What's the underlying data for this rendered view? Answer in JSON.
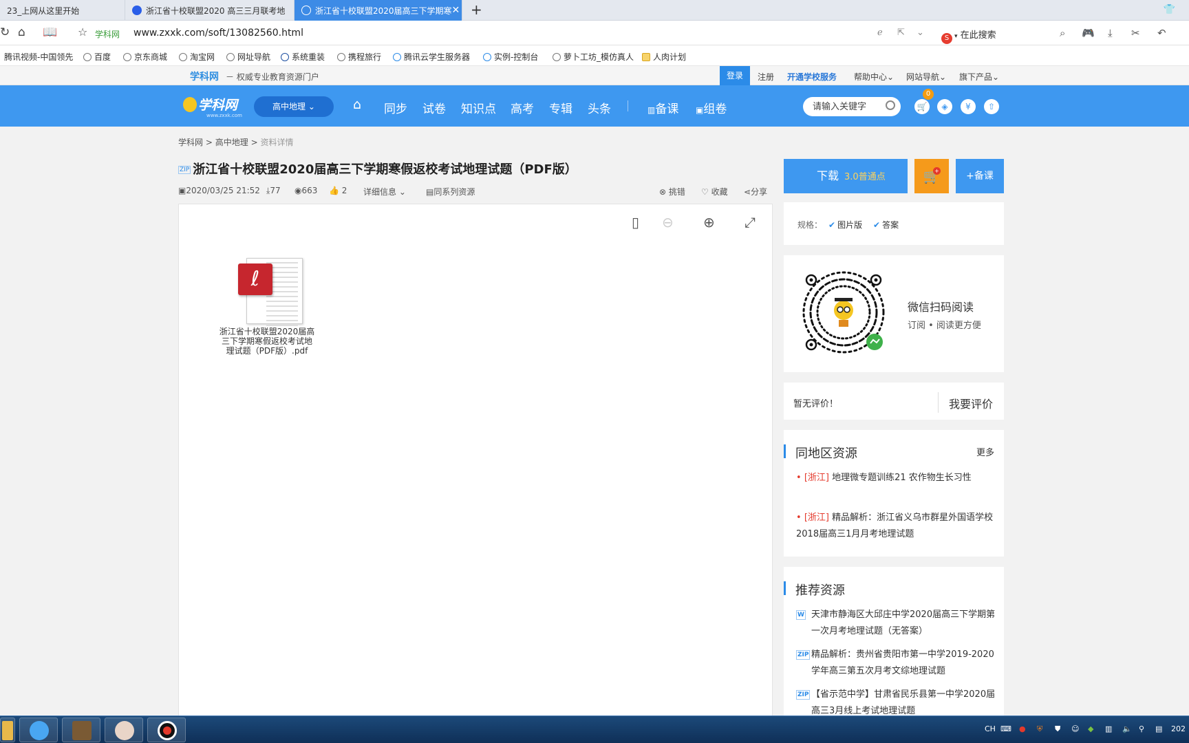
{
  "browser": {
    "tabs": [
      {
        "label": "23_上网从这里开始"
      },
      {
        "label": "浙江省十校联盟2020 高三三月联考地"
      },
      {
        "label": "浙江省十校联盟2020届高三下学期寒"
      }
    ],
    "site_label": "学科网",
    "url": "www.zxxk.com/soft/13082560.html",
    "search_placeholder": "在此搜索",
    "bookmarks": [
      "腾讯视频-中国领先",
      "百度",
      "京东商城",
      "淘宝网",
      "网址导航",
      "系统重装",
      "携程旅行",
      "腾讯云学生服务器",
      "实例-控制台",
      "萝卜工坊_模仿真人",
      "人肉计划"
    ]
  },
  "site_top": {
    "logo": "学科网",
    "slogan": "－ 权威专业教育资源门户",
    "login": "登录",
    "register": "注册",
    "school_service": "开通学校服务",
    "help": "帮助中心",
    "site_nav": "网站导航",
    "products": "旗下产品"
  },
  "header": {
    "brand": "学科网",
    "brand_sub": "www.zxxk.com",
    "subject": "高中地理",
    "nav": [
      "同步",
      "试卷",
      "知识点",
      "高考",
      "专辑",
      "头条"
    ],
    "nav_extra": [
      "备课",
      "组卷"
    ],
    "search_placeholder": "请输入关键字",
    "cart_count": "0"
  },
  "breadcrumb": [
    "学科网",
    "高中地理",
    "资料详情"
  ],
  "doc": {
    "file_type": "ZIP",
    "title": "浙江省十校联盟2020届高三下学期寒假返校考试地理试题（PDF版）",
    "date": "2020/03/25 21:52",
    "downloads": "77",
    "views": "663",
    "likes": "2",
    "detail_info": "详细信息",
    "series": "同系列资源",
    "report": "挑错",
    "favorite": "收藏",
    "share": "分享",
    "file_name": "浙江省十校联盟2020届高三下学期寒假返校考试地理试题（PDF版）.pdf"
  },
  "sidebar": {
    "download": "下载",
    "points": "3.0普通点",
    "prep": "+备课",
    "spec_label": "规格：",
    "specs": [
      "图片版",
      "答案"
    ],
    "wechat_title": "微信扫码阅读",
    "wechat_sub": "订阅 • 阅读更方便",
    "no_review": "暂无评价！",
    "write_review": "我要评价",
    "local_title": "同地区资源",
    "more": "更多",
    "local_items": [
      {
        "tag": "[浙江]",
        "text": "地理微专题训练21 农作物生长习性"
      },
      {
        "tag": "[浙江]",
        "text": "精品解析：浙江省义乌市群星外国语学校2018届高三1月月考地理试题"
      }
    ],
    "recommend_title": "推荐资源",
    "recommend_items": [
      {
        "type": "W",
        "text": "天津市静海区大邱庄中学2020届高三下学期第一次月考地理试题（无答案）"
      },
      {
        "type": "ZIP",
        "text": "精品解析：贵州省贵阳市第一中学2019-2020学年高三第五次月考文综地理试题"
      },
      {
        "type": "ZIP",
        "text": "【省示范中学】甘肃省民乐县第一中学2020届高三3月线上考试地理试题"
      }
    ]
  },
  "taskbar": {
    "lang": "CH",
    "clock": "202"
  }
}
